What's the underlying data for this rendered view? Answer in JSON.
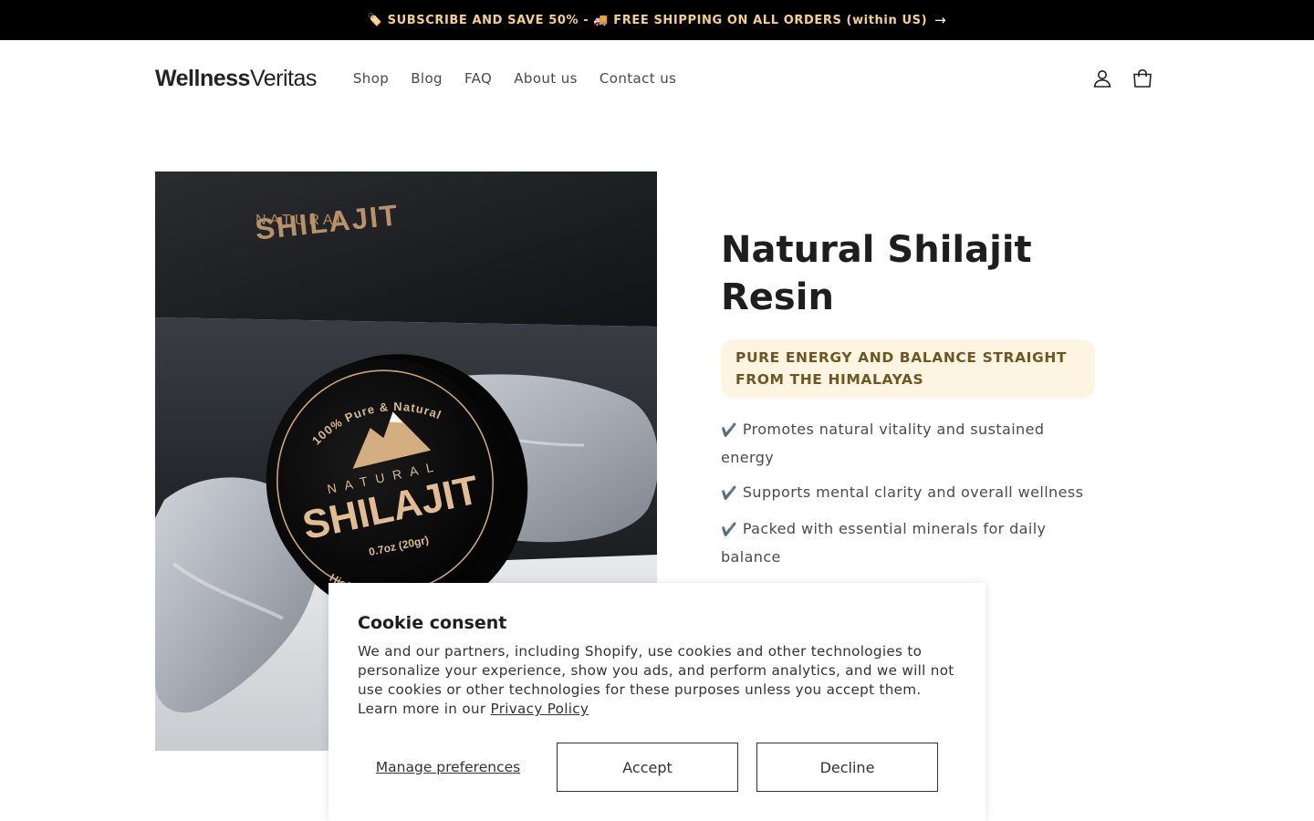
{
  "announcement": {
    "text": "🏷️ SUBSCRIBE AND SAVE 50% - 🚚 FREE SHIPPING ON ALL ORDERS (within US)",
    "arrow_icon": "arrow-right-icon"
  },
  "header": {
    "logo_part1": "Wellness",
    "logo_part2": "Veritas",
    "nav": [
      "Shop",
      "Blog",
      "FAQ",
      "About us",
      "Contact us"
    ],
    "icons": [
      "account-icon",
      "cart-icon"
    ]
  },
  "product": {
    "title": "Natural Shilajit Resin",
    "tagline": "PURE ENERGY AND BALANCE STRAIGHT FROM THE HIMALAYAS",
    "benefits": [
      "Promotes natural vitality and sustained energy",
      "Supports mental clarity and overall wellness",
      "Packed with essential minerals for daily balance"
    ],
    "image": {
      "box_text": "SHILAJIT",
      "box_small": "NATURAL",
      "jar_arc_text": "100% Pure & Natural",
      "jar_top": "NATURAL",
      "jar_main": "SHILAJIT",
      "jar_weight": "0.7oz (20gr)",
      "jar_bottom": "High-Altit"
    }
  },
  "cookie": {
    "title": "Cookie consent",
    "body": "We and our partners, including Shopify, use cookies and other technologies to personalize your experience, show you ads, and perform analytics, and we will not use cookies or other technologies for these purposes unless you accept them. Learn more in our ",
    "link": "Privacy Policy",
    "manage": "Manage preferences",
    "accept": "Accept",
    "decline": "Decline"
  },
  "colors": {
    "announcement_bg": "#000000",
    "announcement_text": "#f5d08a",
    "tagline_bg": "#fdf4e1",
    "tagline_text": "#6e5724"
  }
}
